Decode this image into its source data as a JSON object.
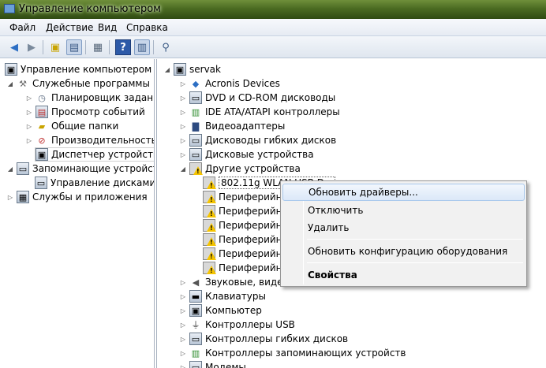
{
  "window": {
    "title": "Управление компьютером"
  },
  "menu": [
    "Файл",
    "Действие",
    "Вид",
    "Справка"
  ],
  "toolbar_icons": [
    "back-arrow-icon",
    "forward-arrow-icon",
    "up-folder-icon",
    "show-hide-tree-icon",
    "properties-icon",
    "help-icon",
    "action-pane-icon",
    "scan-hardware-icon"
  ],
  "left_tree": [
    {
      "label": "Управление компьютером (л",
      "icon": "computer-management-icon"
    },
    {
      "label": "Служебные программы",
      "icon": "tools-icon"
    },
    {
      "label": "Планировщик заданий",
      "icon": "clock-icon"
    },
    {
      "label": "Просмотр событий",
      "icon": "event-viewer-icon"
    },
    {
      "label": "Общие папки",
      "icon": "shared-folder-icon"
    },
    {
      "label": "Производительность",
      "icon": "performance-icon"
    },
    {
      "label": "Диспетчер устройств",
      "icon": "device-manager-icon"
    },
    {
      "label": "Запоминающие устройст",
      "icon": "storage-icon"
    },
    {
      "label": "Управление дисками",
      "icon": "disk-icon"
    },
    {
      "label": "Службы и приложения",
      "icon": "services-icon"
    }
  ],
  "right_tree": {
    "root": "servak",
    "categories": [
      "Acronis Devices",
      "DVD и CD-ROM дисководы",
      "IDE ATA/ATAPI контроллеры",
      "Видеоадаптеры",
      "Дисководы гибких дисков",
      "Дисковые устройства",
      "Другие устройства"
    ],
    "other_devices": [
      "802.11g WLAN USB D...",
      "Периферийно",
      "Периферийно",
      "Периферийно",
      "Периферийно",
      "Периферийно",
      "Периферийно"
    ],
    "more_categories": [
      "Звуковые, видео",
      "Клавиатуры",
      "Компьютер",
      "Контроллеры USB",
      "Контроллеры гибких дисков",
      "Контроллеры запоминающих устройств",
      "Модемы"
    ]
  },
  "context_menu": {
    "update_drivers": "Обновить драйверы...",
    "disable": "Отключить",
    "delete": "Удалить",
    "scan": "Обновить конфигурацию оборудования",
    "properties": "Свойства"
  }
}
